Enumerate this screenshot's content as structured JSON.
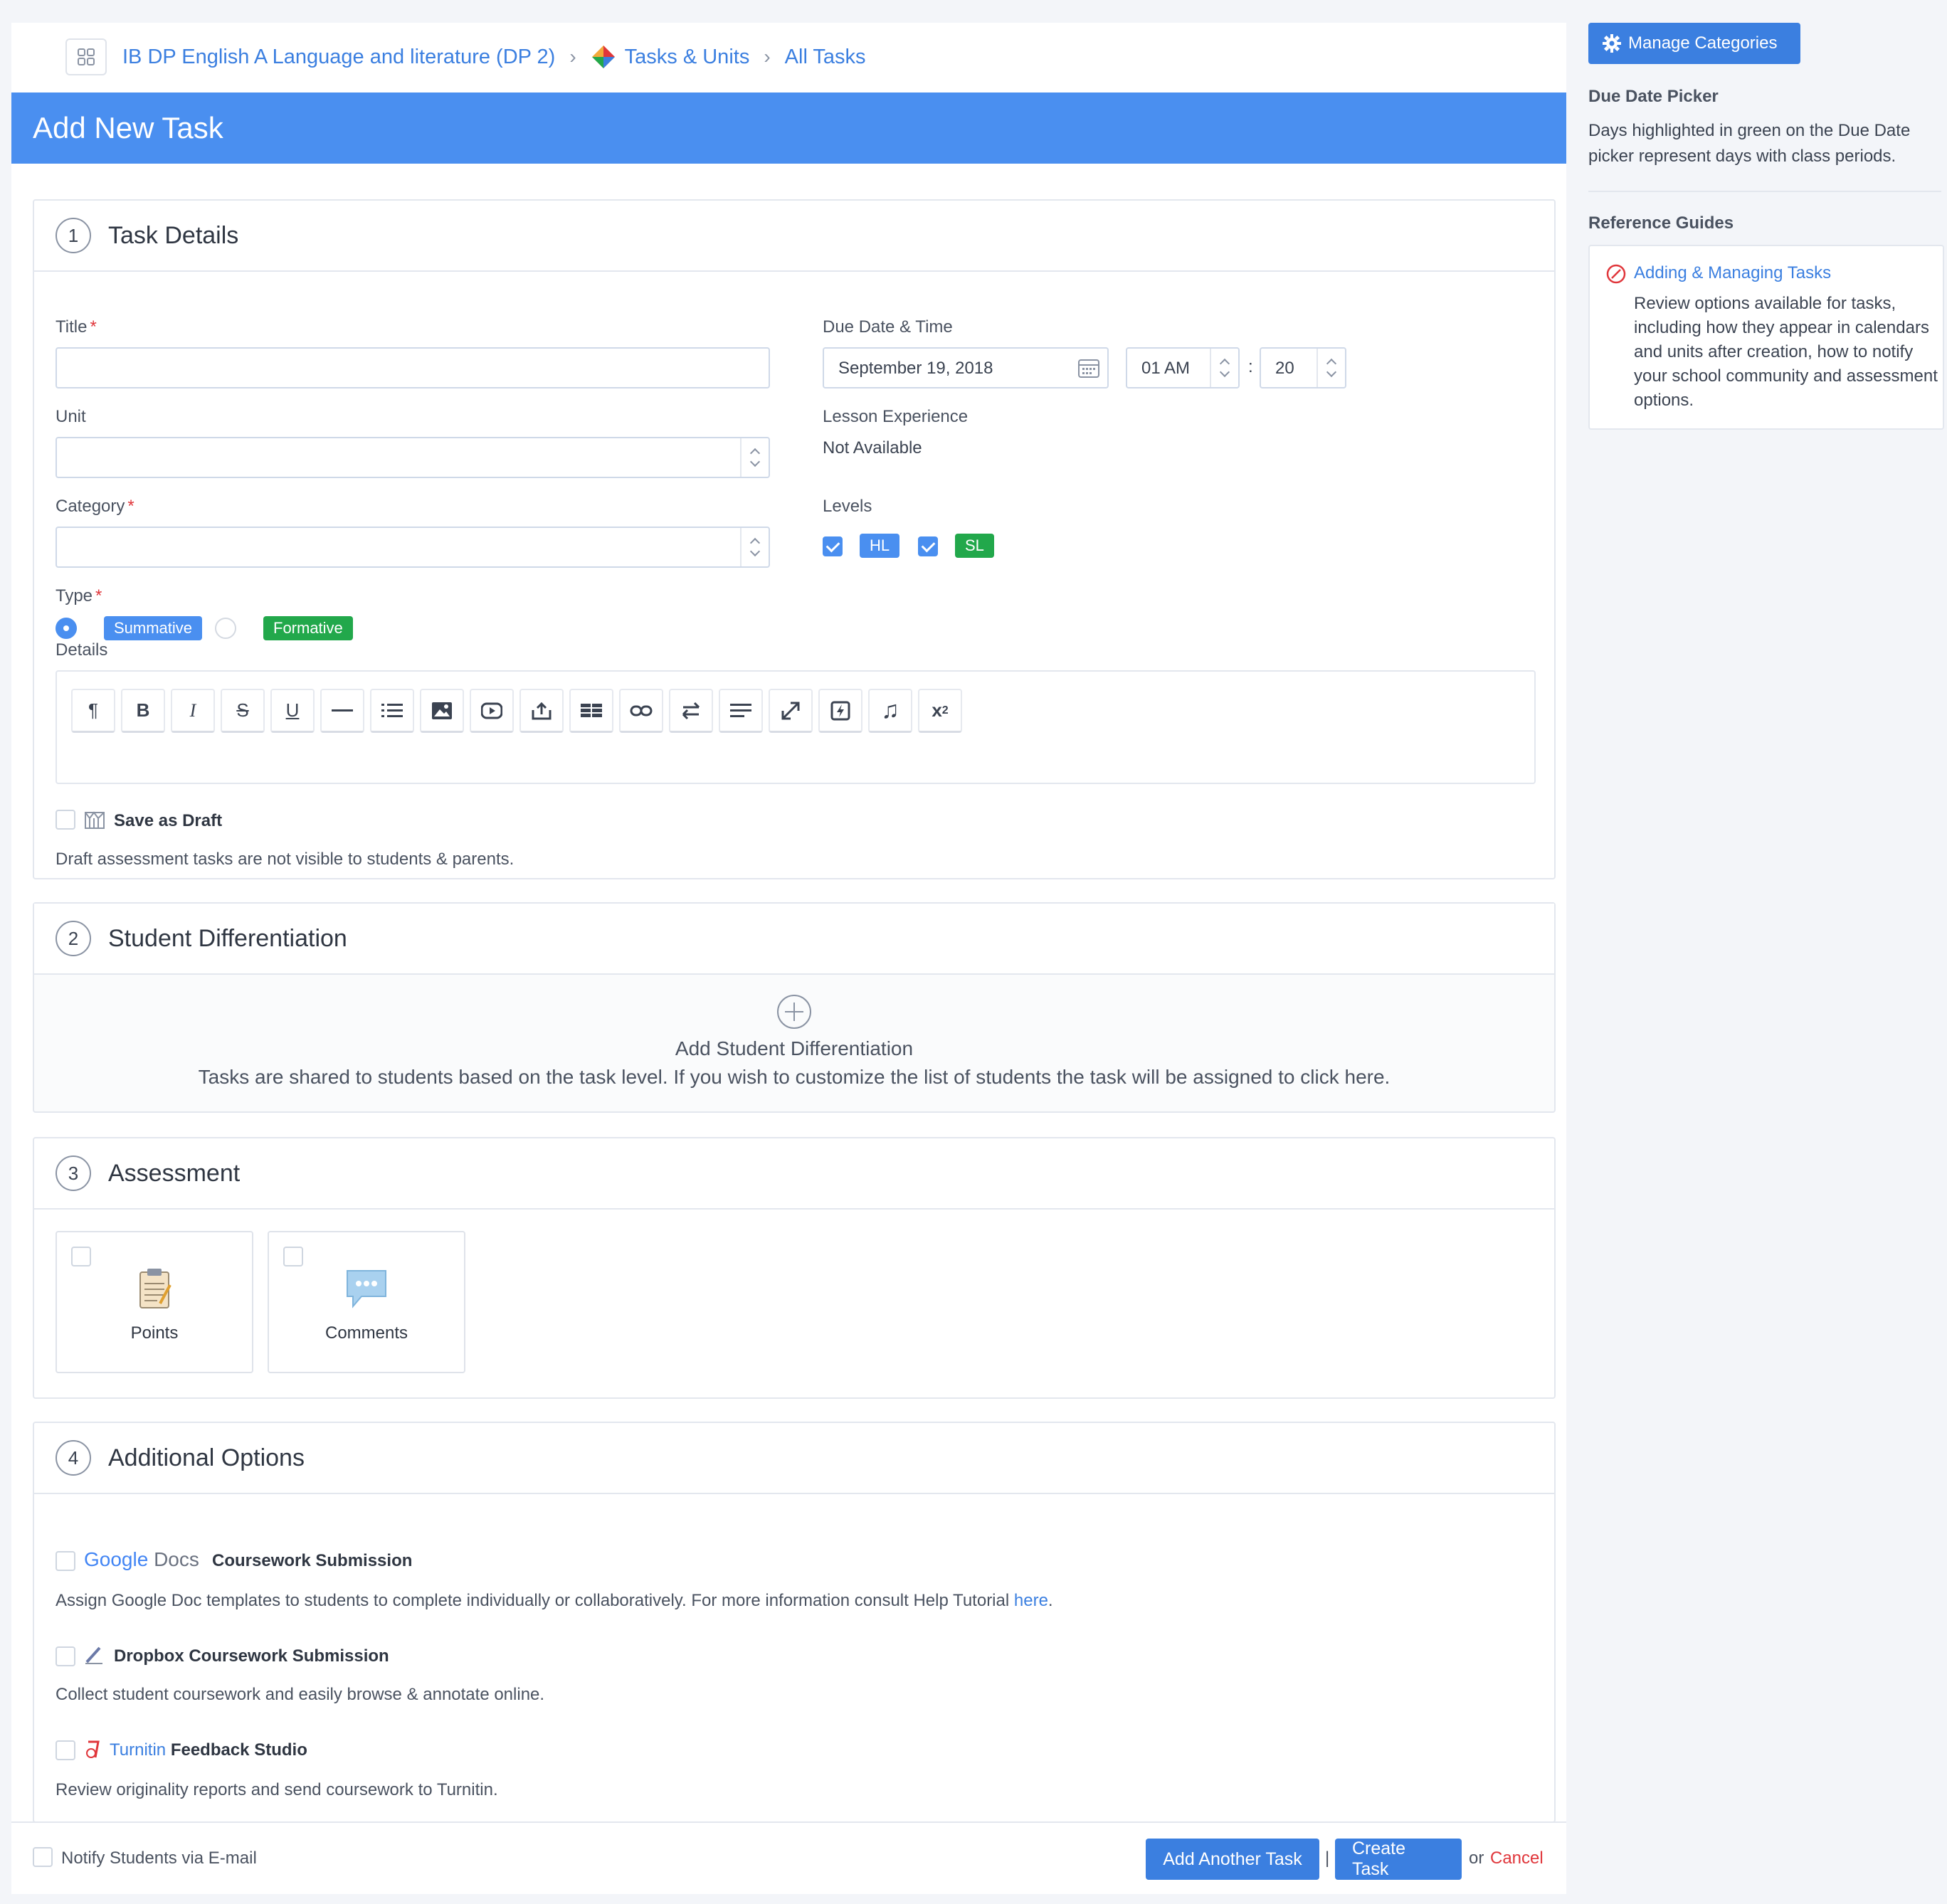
{
  "breadcrumb": {
    "course": "IB DP English A Language and literature (DP 2)",
    "tasks_units": "Tasks & Units",
    "all_tasks": "All Tasks"
  },
  "page_title": "Add New Task",
  "task_details": {
    "number": "1",
    "title": "Task Details",
    "title_label": "Title",
    "title_value": "",
    "unit_label": "Unit",
    "category_label": "Category",
    "type_label": "Type",
    "type_options": [
      "Summative",
      "Formative"
    ],
    "type_selected": "Summative",
    "due_label": "Due Date & Time",
    "due_date": "September 19, 2018",
    "due_hour": "01 AM",
    "time_sep": ":",
    "due_minute": "20",
    "lesson_label": "Lesson Experience",
    "lesson_value": "Not Available",
    "levels_label": "Levels",
    "levels": [
      {
        "label": "HL",
        "checked": true
      },
      {
        "label": "SL",
        "checked": true
      }
    ],
    "details_label": "Details",
    "save_draft_label": "Save as Draft",
    "draft_help": "Draft assessment tasks are not visible to students & parents."
  },
  "editor_toolbar": [
    "paragraph-icon",
    "bold-icon",
    "italic-icon",
    "strikethrough-icon",
    "underline-icon",
    "horizontal-rule-icon",
    "list-icon",
    "image-icon",
    "video-icon",
    "upload-icon",
    "table-icon",
    "link-icon",
    "direction-icon",
    "align-icon",
    "fullscreen-icon",
    "flash-icon",
    "audio-icon",
    "superscript-icon"
  ],
  "student_diff": {
    "number": "2",
    "title": "Student Differentiation",
    "add_label": "Add Student Differentiation",
    "help": "Tasks are shared to students based on the task level. If you wish to customize the list of students the task will be assigned to click here."
  },
  "assessment": {
    "number": "3",
    "title": "Assessment",
    "options": [
      "Points",
      "Comments"
    ]
  },
  "additional": {
    "number": "4",
    "title": "Additional Options",
    "google_brand": "Google",
    "google_docs": "Docs",
    "google_label": "Coursework Submission",
    "google_help": "Assign Google Doc templates to students to complete individually or collaboratively. For more information consult Help Tutorial",
    "google_help_link": "here",
    "google_help_end": ".",
    "dropbox_label": "Dropbox Coursework Submission",
    "dropbox_help": "Collect student coursework and easily browse & annotate online.",
    "turnitin_brand": "Turnitin",
    "turnitin_label": "Feedback Studio",
    "turnitin_help": "Review originality reports and send coursework to Turnitin."
  },
  "footer": {
    "notify_label": "Notify Students via E-mail",
    "add_another": "Add Another Task",
    "divider": "|",
    "create": "Create Task",
    "or": "or",
    "cancel": "Cancel"
  },
  "sidebar": {
    "manage_categories": "Manage Categories",
    "due_picker_title": "Due Date Picker",
    "due_picker_text": "Days highlighted in green on the Due Date picker represent days with class periods.",
    "ref_title": "Reference Guides",
    "guide_link": "Adding & Managing Tasks",
    "guide_text": "Review options available for tasks, including how they appear in calendars and units after creation, how to notify your school community and assessment options."
  },
  "colors": {
    "accent": "#4a8ff0",
    "button": "#3b7fe0",
    "success": "#22a84b",
    "danger": "#e0363b"
  }
}
